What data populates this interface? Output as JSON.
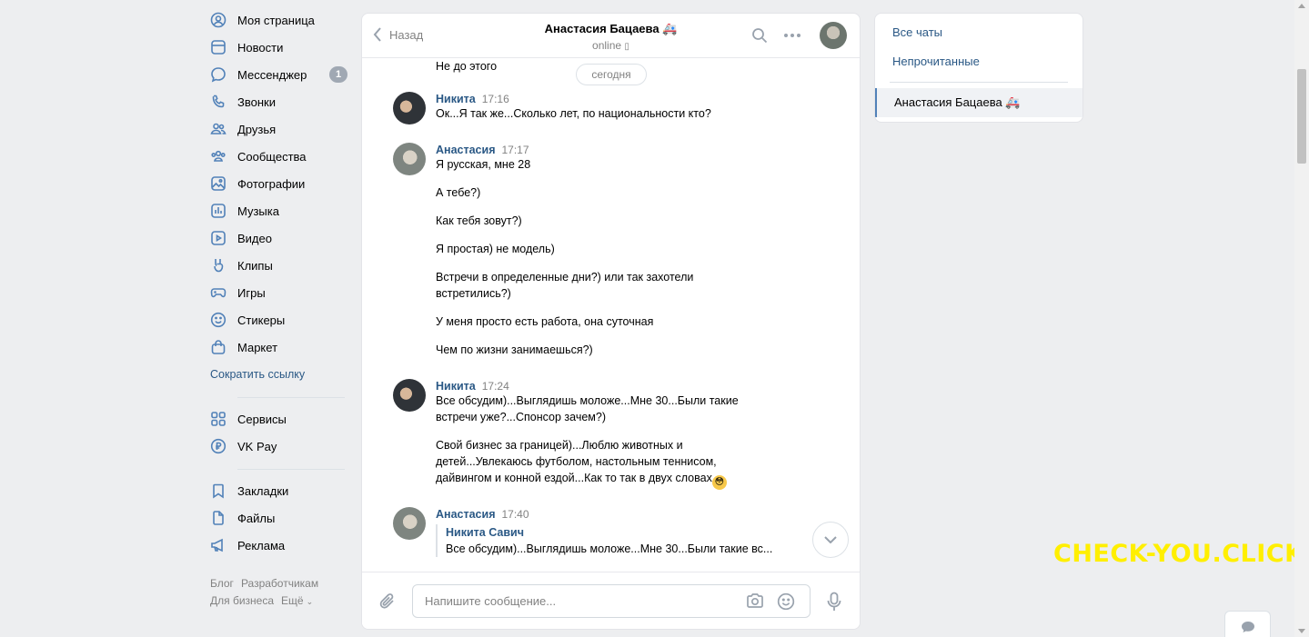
{
  "nav": {
    "items": [
      {
        "label": "Моя страница",
        "icon": "user-circle-icon"
      },
      {
        "label": "Новости",
        "icon": "news-icon"
      },
      {
        "label": "Мессенджер",
        "icon": "message-icon",
        "badge": "1"
      },
      {
        "label": "Звонки",
        "icon": "phone-icon"
      },
      {
        "label": "Друзья",
        "icon": "friends-icon"
      },
      {
        "label": "Сообщества",
        "icon": "communities-icon"
      },
      {
        "label": "Фотографии",
        "icon": "photos-icon"
      },
      {
        "label": "Музыка",
        "icon": "music-icon"
      },
      {
        "label": "Видео",
        "icon": "video-icon"
      },
      {
        "label": "Клипы",
        "icon": "clips-icon"
      },
      {
        "label": "Игры",
        "icon": "games-icon"
      },
      {
        "label": "Стикеры",
        "icon": "stickers-icon"
      },
      {
        "label": "Маркет",
        "icon": "market-icon"
      }
    ],
    "shorten_link": "Сократить ссылку",
    "items2": [
      {
        "label": "Сервисы",
        "icon": "services-icon"
      },
      {
        "label": "VK Pay",
        "icon": "vkpay-icon"
      }
    ],
    "items3": [
      {
        "label": "Закладки",
        "icon": "bookmark-icon"
      },
      {
        "label": "Файлы",
        "icon": "files-icon"
      },
      {
        "label": "Реклама",
        "icon": "ads-icon"
      }
    ],
    "footer": {
      "blog": "Блог",
      "dev": "Разработчикам",
      "business": "Для бизнеса",
      "more": "Ещё"
    }
  },
  "chat": {
    "back_label": "Назад",
    "title": "Анастасия Бацаева 🚑",
    "status": "online",
    "date_pill": "сегодня",
    "first_line": "Не до этого",
    "groups": [
      {
        "author": "Никита",
        "time": "17:16",
        "lines": [
          "Ок...Я так же...Сколько лет, по национальности кто?"
        ]
      },
      {
        "author": "Анастасия",
        "time": "17:17",
        "lines": [
          "Я русская, мне 28",
          "А тебе?)",
          "Как тебя зовут?)",
          "Я простая) не модель)",
          "Встречи в определенные дни?) или так захотели",
          "встретились?)",
          "У меня просто есть работа, она суточная",
          "Чем по жизни занимаешься?)"
        ]
      },
      {
        "author": "Никита",
        "time": "17:24",
        "lines": [
          "Все обсудим)...Выглядишь моложе...Мне 30...Были такие",
          "встречи уже?...Спонсор зачем?)",
          "Свой бизнес за границей)...Люблю животных и",
          "детей...Увлекаюсь футболом, настольным теннисом,",
          "дайвингом и конной ездой...Как то так в двух словах"
        ]
      },
      {
        "author": "Анастасия",
        "time": "17:40",
        "reply_name": "Никита Савич",
        "reply_text": "Все обсудим)...Выглядишь моложе...Мне 30...Были такие вс..."
      }
    ],
    "emoji": "😳",
    "input_placeholder": "Напишите сообщение..."
  },
  "right_panel": {
    "all_chats": "Все чаты",
    "unread": "Непрочитанные",
    "active_chat": "Анастасия Бацаева 🚑"
  },
  "watermark": "CHECK-YOU.CLICK"
}
